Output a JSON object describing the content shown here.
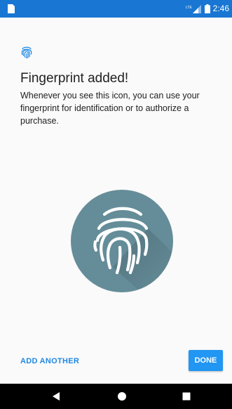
{
  "status_bar": {
    "time": "2:46",
    "network": "LTE"
  },
  "header": {
    "title": "Fingerprint added!",
    "description": "Whenever you see this icon, you can use your fingerprint for identification or to authorize a purchase."
  },
  "illustration": {
    "icon": "fingerprint-icon",
    "circle_color": "#658d99"
  },
  "actions": {
    "add_another_label": "ADD ANOTHER",
    "done_label": "DONE"
  },
  "navigation": {
    "back_icon": "back-triangle-icon",
    "home_icon": "home-circle-icon",
    "recents_icon": "recents-square-icon"
  },
  "colors": {
    "status_bar": "#1976d2",
    "accent": "#2196f3",
    "text_button": "#1e88e5",
    "background": "#fafafa"
  }
}
